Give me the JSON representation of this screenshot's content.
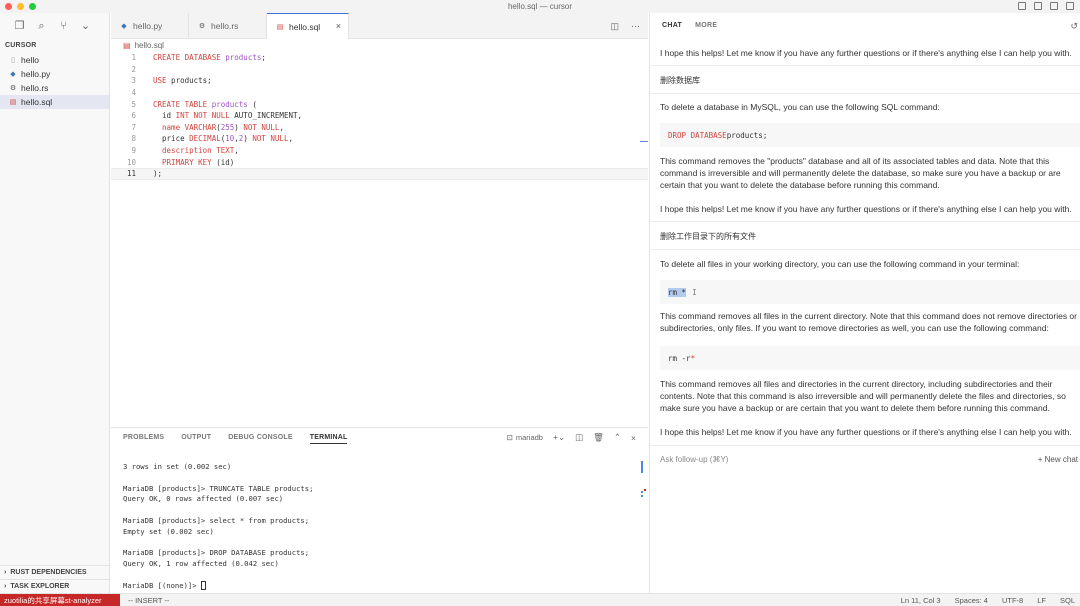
{
  "window": {
    "title": "hello.sql — cursor",
    "traffic_colors": [
      "#ff5f57",
      "#febc2e",
      "#28c840"
    ]
  },
  "sidebar": {
    "header": "CURSOR",
    "files": [
      {
        "name": "hello",
        "icon": "file-icon",
        "glyph": "▯",
        "color": "#999"
      },
      {
        "name": "hello.py",
        "icon": "python-file-icon",
        "glyph": "◆",
        "color": "#3b77b8"
      },
      {
        "name": "hello.rs",
        "icon": "rust-file-icon",
        "glyph": "⚙",
        "color": "#555"
      },
      {
        "name": "hello.sql",
        "icon": "sql-file-icon",
        "glyph": "▤",
        "color": "#d0443f"
      }
    ],
    "sections": [
      "RUST DEPENDENCIES",
      "TASK EXPLORER"
    ]
  },
  "tabs": [
    {
      "label": "hello.py",
      "icon": "python-file-icon",
      "glyph": "◆",
      "color": "#3b77b8"
    },
    {
      "label": "hello.rs",
      "icon": "rust-file-icon",
      "glyph": "⚙",
      "color": "#555"
    },
    {
      "label": "hello.sql",
      "icon": "sql-file-icon",
      "glyph": "▤",
      "color": "#d0443f",
      "close": "×"
    }
  ],
  "editor": {
    "breadcrumb": "hello.sql",
    "line_numbers": [
      "1",
      "2",
      "3",
      "4",
      "5",
      "6",
      "7",
      "8",
      "9",
      "10",
      "11"
    ],
    "current_line": 11
  },
  "panel": {
    "tabs": [
      "PROBLEMS",
      "OUTPUT",
      "DEBUG CONSOLE",
      "TERMINAL"
    ],
    "active_tab": "TERMINAL",
    "terminal_name": "mariadb",
    "terminal_lines": [
      "3 rows in set (0.002 sec)",
      "",
      "MariaDB [products]> TRUNCATE TABLE products;",
      "Query OK, 0 rows affected (0.007 sec)",
      "",
      "MariaDB [products]> select * from products;",
      "Empty set (0.002 sec)",
      "",
      "MariaDB [products]> DROP DATABASE products;",
      "Query OK, 1 row affected (0.042 sec)",
      "",
      "MariaDB [(none)]> "
    ]
  },
  "statusbar": {
    "remote": "zuotilia的共享屏幕st-analyzer",
    "mode": "-- INSERT --",
    "position": "Ln 11, Col 3",
    "spaces": "Spaces: 4",
    "encoding": "UTF-8",
    "eol": "LF",
    "language": "SQL"
  },
  "chat": {
    "tabs": [
      "CHAT",
      "MORE"
    ],
    "p1": "I hope this helps! Let me know if you have any further questions or if there's anything else I can help you with.",
    "h1": "删除数据库",
    "p2": "To delete a database in MySQL, you can use the following SQL command:",
    "code1_kw": "DROP DATABASE",
    "code1_rest": " products;",
    "p3_1": "This command removes the \"products\" database and all of its associated tables and data. Note that this",
    "p3_2": "command is irreversible and will permanently delete the database, so make sure you have a backup or are",
    "p3_3": "certain that you want to delete the database before running this command.",
    "p4": "I hope this helps! Let me know if you have any further questions or if there's anything else I can help you with.",
    "h2": "删除工作目录下的所有文件",
    "p5": "To delete all files in your working directory, you can use the following command in your terminal:",
    "code2": "rm *",
    "p6_1": "This command removes all files in the current directory. Note that this command does not remove directories or",
    "p6_2": "subdirectories, only files. If you want to remove directories as well, you can use the following command:",
    "code3_a": "rm -r ",
    "code3_b": "*",
    "p7_1": "This command removes all files and directories in the current directory, including subdirectories and their",
    "p7_2": "contents. Note that this command is also irreversible and will permanently delete the files and directories, so",
    "p7_3": "make sure you have a backup or are certain that you want to delete them before running this command.",
    "p8": "I hope this helps! Let me know if you have any further questions or if there's anything else I can help you with.",
    "ask_placeholder": "Ask follow-up (⌘Y)",
    "new_chat": "+ New chat"
  }
}
